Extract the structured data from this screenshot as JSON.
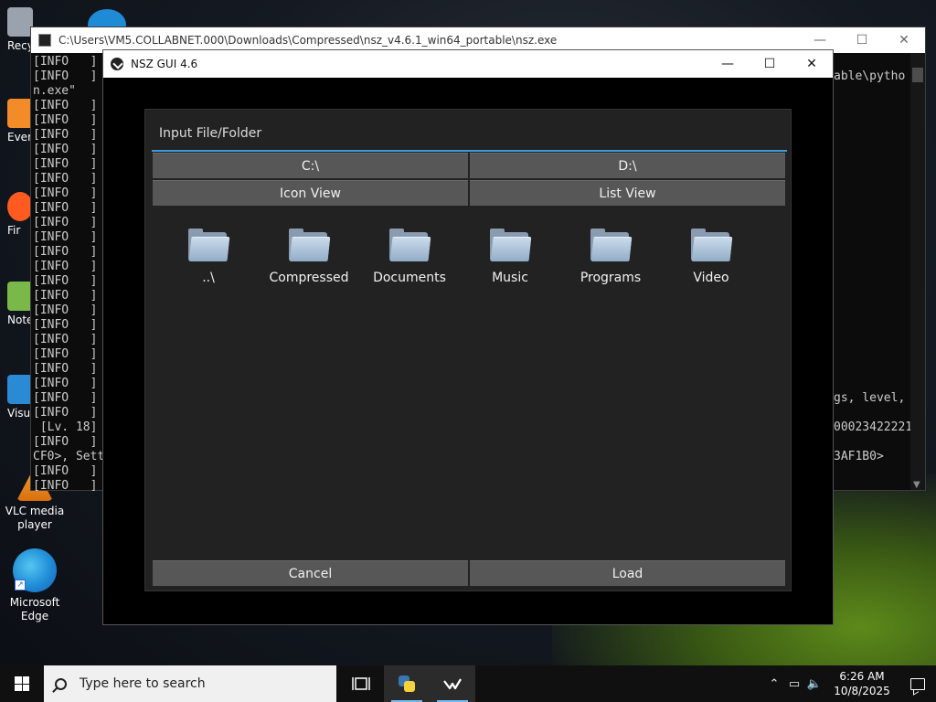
{
  "desktop": {
    "icons": [
      {
        "label": "Recy",
        "color": "#9aa3ad"
      },
      {
        "label": "Ever",
        "color": "#f28c28"
      },
      {
        "label": "Fir",
        "color": "#ff5a1f"
      },
      {
        "label": "Note",
        "color": "#7ab84a"
      },
      {
        "label": "Visua",
        "color": "#2a8ad4"
      },
      {
        "label": "VLC media player",
        "color": "#f08a1a"
      },
      {
        "label": "Microsoft Edge",
        "color": "#1f8bd6"
      }
    ]
  },
  "console": {
    "title": "C:\\Users\\VM5.COLLABNET.000\\Downloads\\Compressed\\nsz_v4.6.1_win64_portable\\nsz.exe",
    "lines": [
      "[INFO   ]",
      "[INFO   ]",
      "n.exe\"",
      "[INFO   ]",
      "[INFO   ]",
      "[INFO   ]",
      "[INFO   ]",
      "[INFO   ]",
      "[INFO   ]",
      "[INFO   ]",
      "[INFO   ]",
      "[INFO   ]",
      "[INFO   ]",
      "[INFO   ]",
      "[INFO   ]",
      "[INFO   ]",
      "[INFO   ]",
      "[INFO   ]",
      "[INFO   ]",
      "[INFO   ]",
      "[INFO   ]",
      "[INFO   ]",
      "[INFO   ]",
      "[INFO   ]",
      "[INFO   ]",
      " [Lv. 18]",
      "[INFO   ]",
      "CF0>, Sett",
      "[INFO   ]",
      "[INFO   ]"
    ],
    "right_fragments": [
      {
        "text": "able\\pytho",
        "row": 1
      },
      {
        "text": "gs, level,",
        "row": 23
      },
      {
        "text": "00023422221",
        "row": 25
      },
      {
        "text": "3AF1B0>",
        "row": 27
      }
    ]
  },
  "nsz": {
    "title": "NSZ GUI 4.6",
    "dialog": {
      "title": "Input File/Folder",
      "drives": [
        "C:\\",
        "D:\\"
      ],
      "views": [
        "Icon View",
        "List View"
      ],
      "files": [
        "..\\",
        "Compressed",
        "Documents",
        "Music",
        "Programs",
        "Video"
      ],
      "cancel_label": "Cancel",
      "load_label": "Load"
    }
  },
  "taskbar": {
    "search_placeholder": "Type here to search",
    "time": "6:26 AM",
    "date": "10/8/2025"
  },
  "colors": {
    "accent": "#3b9ad9",
    "button": "#575757",
    "dialog_bg": "#222222"
  }
}
